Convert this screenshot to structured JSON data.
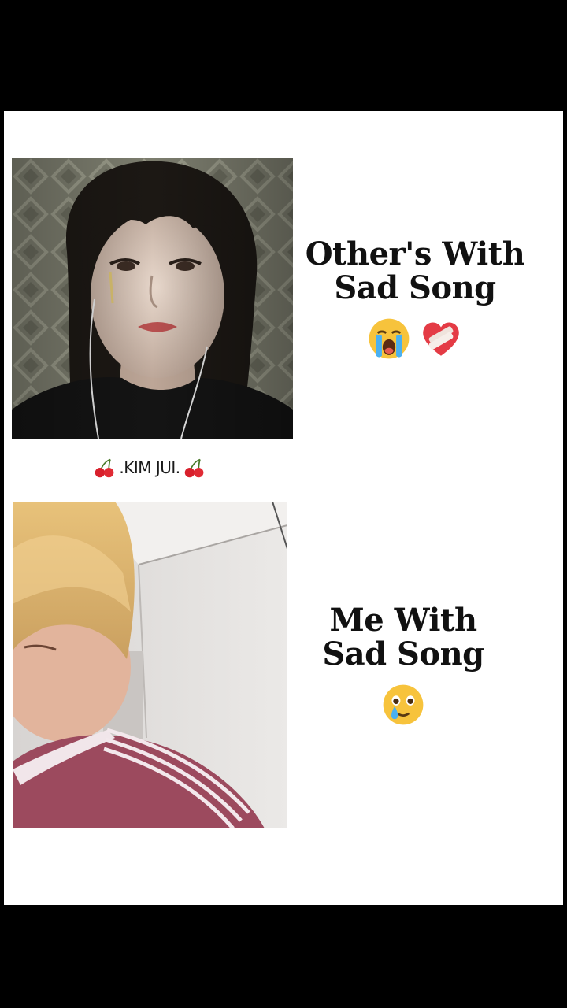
{
  "panels": [
    {
      "caption_line1": "Other's With",
      "caption_line2": "Sad Song",
      "emojis": [
        "loudly-crying-face-icon",
        "mending-heart-icon"
      ]
    },
    {
      "caption_line1": "Me With",
      "caption_line2": "Sad Song",
      "emojis": [
        "face-holding-back-tears-icon"
      ]
    }
  ],
  "watermark": {
    "text": ".KIM JUI.",
    "icon": "cherries-icon"
  },
  "colors": {
    "background": "#000000",
    "card": "#ffffff",
    "text": "#111111"
  }
}
